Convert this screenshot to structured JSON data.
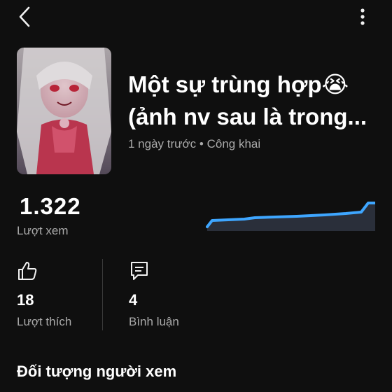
{
  "header": {
    "back_icon": "chevron-left-icon",
    "more_icon": "more-vertical-icon"
  },
  "video": {
    "title_line1": "Một sự trùng hợp😭",
    "title_line2": "(ảnh nv sau là trong...",
    "age": "1 ngày trước",
    "separator": "•",
    "visibility": "Công khai",
    "thumbnail_icon": "anime-thumbnail-image"
  },
  "views": {
    "count": "1.322",
    "label": "Lượt xem",
    "trend_color": "#3ea6ff"
  },
  "stats": {
    "likes": {
      "icon": "thumbs-up-icon",
      "count": "18",
      "label": "Lượt thích"
    },
    "comments": {
      "icon": "comment-icon",
      "count": "4",
      "label": "Bình luận"
    }
  },
  "audience": {
    "title": "Đối tượng người xem"
  }
}
